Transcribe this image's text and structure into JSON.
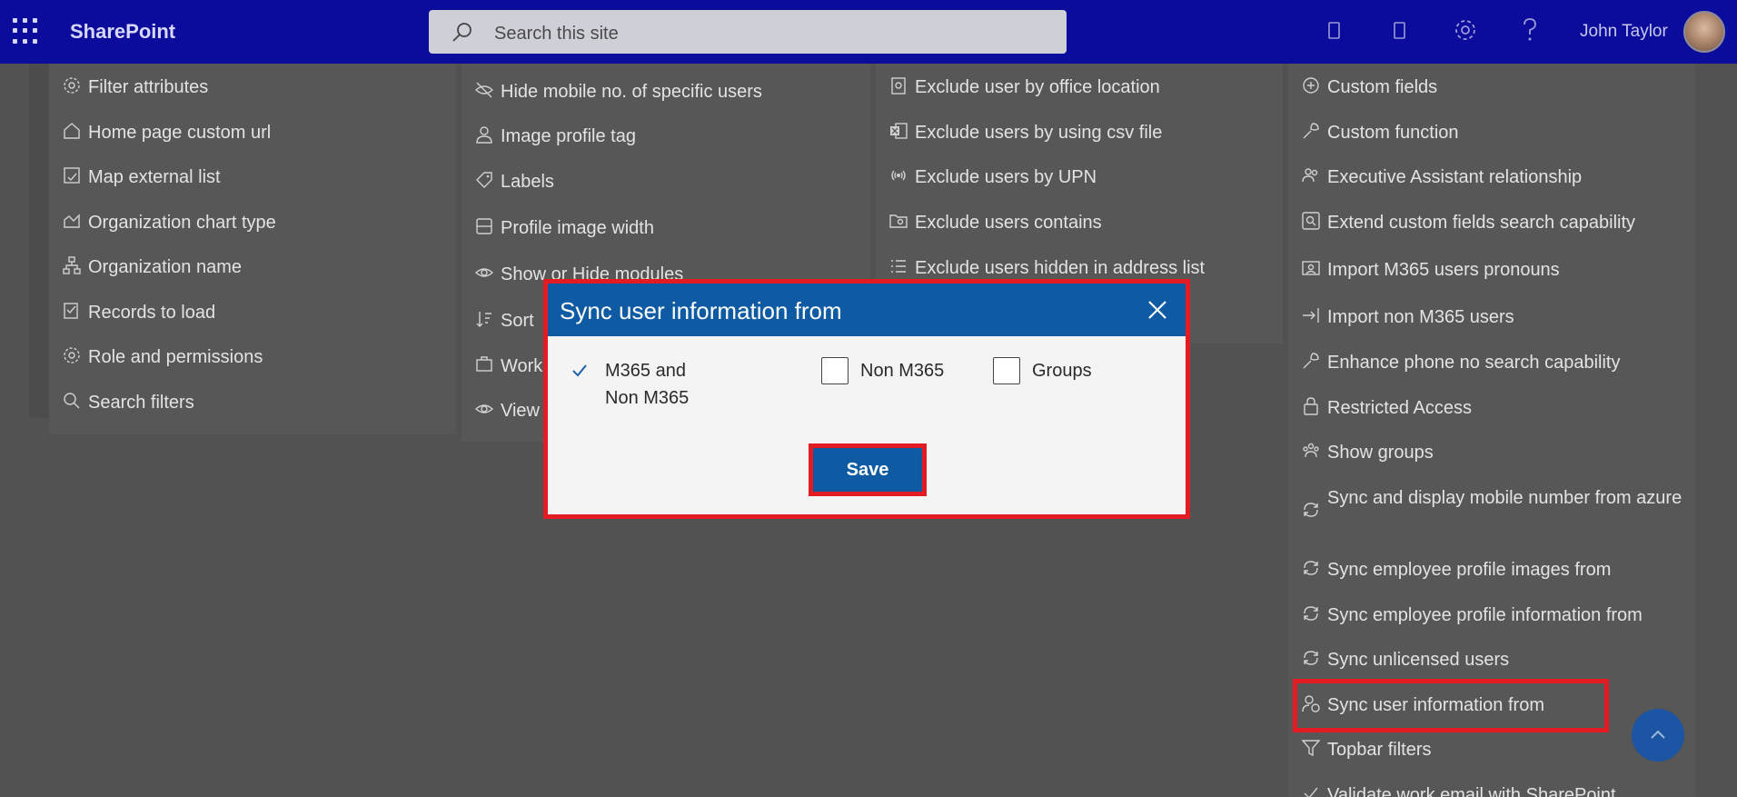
{
  "header": {
    "brand": "SharePoint",
    "search_placeholder": "Search this site",
    "user_name": "John Taylor"
  },
  "columns": {
    "col1": [
      {
        "label": "Filter attributes",
        "icon": "gear-badge-icon"
      },
      {
        "label": "Home page custom url",
        "icon": "home-icon"
      },
      {
        "label": "Map external list",
        "icon": "map-list-icon"
      },
      {
        "label": "Organization chart type",
        "icon": "chart-area-icon"
      },
      {
        "label": "Organization name",
        "icon": "org-tree-icon"
      },
      {
        "label": "Records to load",
        "icon": "checklist-icon"
      },
      {
        "label": "Role and permissions",
        "icon": "gear-badge-icon"
      },
      {
        "label": "Search filters",
        "icon": "search-icon"
      }
    ],
    "col2": [
      {
        "label": "Hide mobile no. of specific users",
        "icon": "eye-off-icon"
      },
      {
        "label": "Image profile tag",
        "icon": "person-icon"
      },
      {
        "label": "Labels",
        "icon": "tag-icon"
      },
      {
        "label": "Profile image width",
        "icon": "layout-icon"
      },
      {
        "label": "Show or Hide modules",
        "icon": "eye-icon"
      },
      {
        "label": "Sort",
        "icon": "sort-icon"
      },
      {
        "label": "Work",
        "icon": "work-icon"
      },
      {
        "label": "View",
        "icon": "eye-icon"
      }
    ],
    "col3": [
      {
        "label": "Exclude user by office location",
        "icon": "building-icon"
      },
      {
        "label": "Exclude users by using csv file",
        "icon": "excel-icon"
      },
      {
        "label": "Exclude users by UPN",
        "icon": "broadcast-icon"
      },
      {
        "label": "Exclude users contains",
        "icon": "folder-search-icon"
      },
      {
        "label": "Exclude users hidden in address list",
        "icon": "list-icon"
      }
    ],
    "col4": [
      {
        "label": "Custom fields",
        "icon": "plus-circle-icon"
      },
      {
        "label": "Custom function",
        "icon": "wrench-icon"
      },
      {
        "label": "Executive Assistant relationship",
        "icon": "people-icon"
      },
      {
        "label": "Extend custom fields search capability",
        "icon": "search-box-icon"
      },
      {
        "label": "Import M365 users pronouns",
        "icon": "contact-card-icon"
      },
      {
        "label": "Import non M365 users",
        "icon": "import-icon"
      },
      {
        "label": "Enhance phone no search capability",
        "icon": "wrench-icon"
      },
      {
        "label": "Restricted Access",
        "icon": "lock-icon"
      },
      {
        "label": "Show groups",
        "icon": "group-icon"
      },
      {
        "label": "Sync and display mobile number from azure",
        "icon": "sync-icon"
      },
      {
        "label": "Sync employee profile images from",
        "icon": "sync-icon"
      },
      {
        "label": "Sync employee profile information from",
        "icon": "sync-icon"
      },
      {
        "label": "Sync unlicensed users",
        "icon": "sync-icon"
      },
      {
        "label": "Sync user information from",
        "icon": "person-sync-icon"
      },
      {
        "label": "Topbar filters",
        "icon": "filter-icon"
      },
      {
        "label": "Validate work email with SharePoint",
        "icon": "check-icon"
      }
    ]
  },
  "dialog": {
    "title": "Sync user information from",
    "options": [
      {
        "label": "M365 and Non M365",
        "checked": true
      },
      {
        "label": "Non M365",
        "checked": false
      },
      {
        "label": "Groups",
        "checked": false
      }
    ],
    "save_label": "Save"
  },
  "colors": {
    "topbar": "#0b0b9c",
    "dialog_header": "#0e5aa3",
    "highlight": "#e31b23"
  }
}
